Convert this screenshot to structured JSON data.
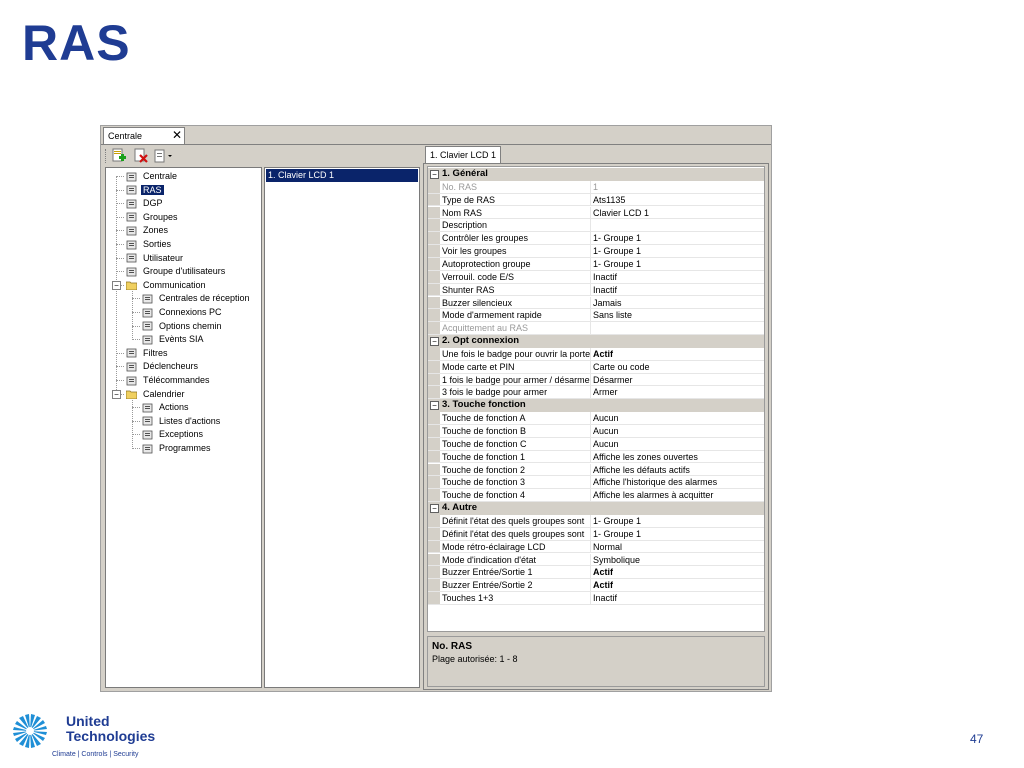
{
  "slide": {
    "title": "RAS",
    "page_number": "47"
  },
  "logo": {
    "line1": "United",
    "line2": "Technologies",
    "line3": "Climate | Controls | Security"
  },
  "app": {
    "doc_tab": {
      "label": "Centrale",
      "close": "✕"
    },
    "toolbar": [
      {
        "icon": "add-icon"
      },
      {
        "icon": "delete-icon"
      },
      {
        "icon": "properties-dropdown-icon"
      }
    ],
    "tree": [
      {
        "label": "Centrale",
        "icon": "panel-icon"
      },
      {
        "label": "RAS",
        "icon": "keypad-icon",
        "selected": true
      },
      {
        "label": "DGP",
        "icon": "dgp-icon"
      },
      {
        "label": "Groupes",
        "icon": "groups-icon"
      },
      {
        "label": "Zones",
        "icon": "zones-icon"
      },
      {
        "label": "Sorties",
        "icon": "outputs-icon"
      },
      {
        "label": "Utilisateur",
        "icon": "user-icon"
      },
      {
        "label": "Groupe d'utilisateurs",
        "icon": "user-group-icon"
      },
      {
        "label": "Communication",
        "icon": "folder-icon",
        "expanded": true
      },
      {
        "label": "Centrales de réception",
        "icon": "receivers-icon"
      },
      {
        "label": "Connexions PC",
        "icon": "pc-icon"
      },
      {
        "label": "Options chemin",
        "icon": "path-icon"
      },
      {
        "label": "Evènts SIA",
        "icon": "sia-icon"
      },
      {
        "label": "Filtres",
        "icon": "filter-icon"
      },
      {
        "label": "Déclencheurs",
        "icon": "trigger-icon"
      },
      {
        "label": "Télécommandes",
        "icon": "remote-icon"
      },
      {
        "label": "Calendrier",
        "icon": "folder-icon",
        "expanded": true
      },
      {
        "label": "Actions",
        "icon": "actions-icon"
      },
      {
        "label": "Listes d'actions",
        "icon": "action-list-icon"
      },
      {
        "label": "Exceptions",
        "icon": "exceptions-icon"
      },
      {
        "label": "Programmes",
        "icon": "programs-icon"
      }
    ],
    "list": {
      "selected_item": "1. Clavier LCD 1"
    },
    "properties": {
      "tab_label": "1. Clavier LCD 1",
      "categories": [
        {
          "title": "1. Général",
          "rows": [
            {
              "name": "No. RAS",
              "value": "1",
              "disabled": true
            },
            {
              "name": "Type de RAS",
              "value": "Ats1135"
            },
            {
              "name": "Nom RAS",
              "value": "Clavier LCD 1"
            },
            {
              "name": "Description",
              "value": ""
            },
            {
              "name": "Contrôler les groupes",
              "value": "1- Groupe 1"
            },
            {
              "name": "Voir les groupes",
              "value": "1- Groupe 1"
            },
            {
              "name": "Autoprotection groupe",
              "value": "1- Groupe 1"
            },
            {
              "name": "Verrouil. code E/S",
              "value": "Inactif"
            },
            {
              "name": "Shunter RAS",
              "value": "Inactif"
            },
            {
              "name": "Buzzer silencieux",
              "value": "Jamais"
            },
            {
              "name": "Mode d'armement rapide",
              "value": "Sans liste"
            },
            {
              "name": "Acquittement au RAS",
              "value": "",
              "disabled": true
            }
          ]
        },
        {
          "title": "2. Opt connexion",
          "rows": [
            {
              "name": "Une fois le badge pour ouvrir la porte",
              "value": "Actif",
              "bold": true
            },
            {
              "name": "Mode carte et PIN",
              "value": "Carte ou code"
            },
            {
              "name": "1 fois le badge pour armer / désarmer",
              "value": "Désarmer"
            },
            {
              "name": "3 fois le badge pour armer",
              "value": "Armer"
            }
          ]
        },
        {
          "title": "3. Touche fonction",
          "rows": [
            {
              "name": "Touche de fonction A",
              "value": "Aucun"
            },
            {
              "name": "Touche de fonction B",
              "value": "Aucun"
            },
            {
              "name": "Touche de fonction C",
              "value": "Aucun"
            },
            {
              "name": "Touche de fonction 1",
              "value": "Affiche les zones ouvertes"
            },
            {
              "name": "Touche de fonction 2",
              "value": "Affiche les défauts actifs"
            },
            {
              "name": "Touche de fonction 3",
              "value": "Affiche l'historique des alarmes"
            },
            {
              "name": "Touche de fonction 4",
              "value": "Affiche les alarmes à acquitter"
            }
          ]
        },
        {
          "title": "4. Autre",
          "rows": [
            {
              "name": "Définit l'état des quels groupes sont",
              "value": "1- Groupe 1"
            },
            {
              "name": "Définit l'état des quels groupes sont",
              "value": "1- Groupe 1"
            },
            {
              "name": "Mode rétro-éclairage LCD",
              "value": "Normal"
            },
            {
              "name": "Mode d'indication d'état",
              "value": "Symbolique"
            },
            {
              "name": "Buzzer Entrée/Sortie 1",
              "value": "Actif",
              "bold": true
            },
            {
              "name": "Buzzer Entrée/Sortie 2",
              "value": "Actif",
              "bold": true
            },
            {
              "name": "Touches 1+3",
              "value": "Inactif"
            }
          ]
        }
      ],
      "help": {
        "title": "No. RAS",
        "description": "Plage autorisée: 1 - 8"
      }
    }
  }
}
